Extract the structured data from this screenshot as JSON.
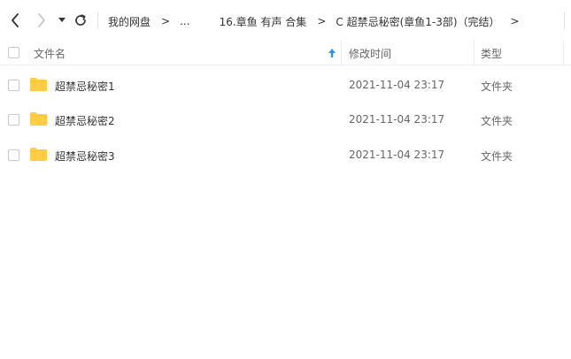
{
  "toolbar": {
    "breadcrumb": [
      {
        "label": "我的网盘"
      },
      {
        "label": "..."
      },
      {
        "label": "16.章鱼 有声 合集"
      },
      {
        "label": "C 超禁忌秘密(章鱼1-3部)（完结）"
      }
    ],
    "separator": ">"
  },
  "columns": {
    "name": "文件名",
    "modified": "修改时间",
    "type": "类型"
  },
  "files": [
    {
      "name": "超禁忌秘密1",
      "modified": "2021-11-04 23:17",
      "type": "文件夹",
      "icon": "folder-icon"
    },
    {
      "name": "超禁忌秘密2",
      "modified": "2021-11-04 23:17",
      "type": "文件夹",
      "icon": "folder-icon"
    },
    {
      "name": "超禁忌秘密3",
      "modified": "2021-11-04 23:17",
      "type": "文件夹",
      "icon": "folder-icon"
    }
  ],
  "colors": {
    "folder": "#FFCE45",
    "sort_arrow": "#2196F3",
    "disabled_arrow": "#c8c8c8"
  }
}
